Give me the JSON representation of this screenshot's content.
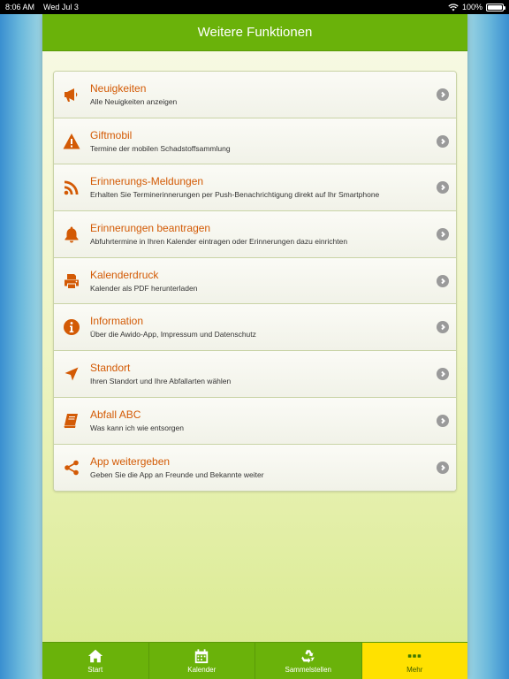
{
  "statusbar": {
    "time": "8:06 AM",
    "date": "Wed Jul 3",
    "battery": "100%"
  },
  "navbar": {
    "title": "Weitere Funktionen"
  },
  "items": [
    {
      "icon": "megaphone-icon",
      "title": "Neuigkeiten",
      "subtitle": "Alle Neuigkeiten anzeigen"
    },
    {
      "icon": "warning-icon",
      "title": "Giftmobil",
      "subtitle": "Termine der mobilen Schadstoffsammlung"
    },
    {
      "icon": "rss-icon",
      "title": "Erinnerungs-Meldungen",
      "subtitle": "Erhalten Sie Terminerinnerungen per Push-Benachrichtigung direkt auf Ihr Smartphone"
    },
    {
      "icon": "bell-icon",
      "title": "Erinnerungen beantragen",
      "subtitle": "Abfuhrtermine in Ihren Kalender eintragen oder Erinnerungen dazu einrichten"
    },
    {
      "icon": "printer-icon",
      "title": "Kalenderdruck",
      "subtitle": "Kalender als PDF herunterladen"
    },
    {
      "icon": "info-icon",
      "title": "Information",
      "subtitle": "Über die Awido-App, Impressum und Datenschutz"
    },
    {
      "icon": "location-arrow-icon",
      "title": "Standort",
      "subtitle": "Ihren Standort und Ihre Abfallarten wählen"
    },
    {
      "icon": "book-icon",
      "title": "Abfall ABC",
      "subtitle": "Was kann ich wie entsorgen"
    },
    {
      "icon": "share-icon",
      "title": "App weitergeben",
      "subtitle": "Geben Sie die App an Freunde und Bekannte weiter"
    }
  ],
  "tabs": [
    {
      "icon": "home-icon",
      "label": "Start"
    },
    {
      "icon": "calendar-icon",
      "label": "Kalender"
    },
    {
      "icon": "recycle-icon",
      "label": "Sammelstellen"
    },
    {
      "icon": "more-icon",
      "label": "Mehr"
    }
  ],
  "colors": {
    "accent": "#d35a05",
    "nav": "#6ab20a",
    "active_tab": "#ffe100"
  }
}
